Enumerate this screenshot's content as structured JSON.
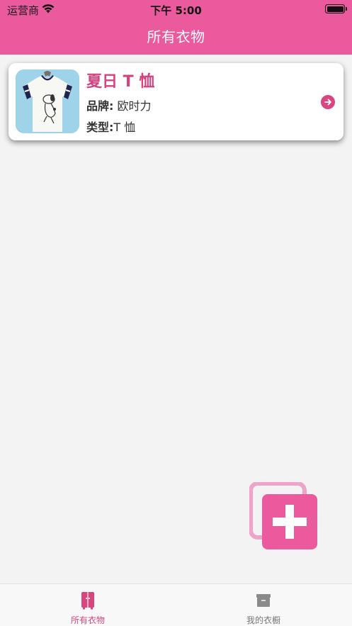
{
  "status_bar": {
    "carrier": "运营商",
    "time": "下午 5:00"
  },
  "nav": {
    "title": "所有衣物"
  },
  "clothes": [
    {
      "name": "夏日 T 恤",
      "brand_label": "品牌:",
      "brand": "欧时力",
      "type_label": "类型:",
      "type": "T 恤"
    }
  ],
  "tabbar": {
    "items": [
      {
        "label": "所有衣物",
        "icon": "wardrobe-icon",
        "active": true
      },
      {
        "label": "我的衣橱",
        "icon": "closet-box-icon",
        "active": false
      }
    ]
  },
  "colors": {
    "accent": "#ec5a9e",
    "accent_dark": "#d8457f",
    "background": "#f3f3f3"
  }
}
